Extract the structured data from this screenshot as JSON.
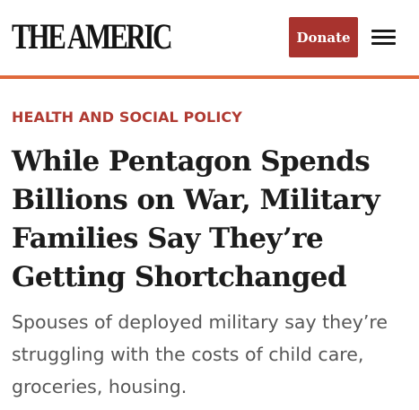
{
  "header": {
    "logo_text": "THE AMERICAN PROSPECT",
    "donate_label": "Donate",
    "menu_icon": "hamburger-menu-icon"
  },
  "colors": {
    "donate_bg": "#a8332e",
    "accent_rule": "#e06a3c",
    "category": "#b03a32"
  },
  "article": {
    "category": "HEALTH AND SOCIAL POLICY",
    "headline": "While Pentagon Spends Billions on War, Military Families Say They’re Getting Shortchanged",
    "dek": "Spouses of deployed military say they’re struggling with the costs of child care, groceries, housing."
  }
}
